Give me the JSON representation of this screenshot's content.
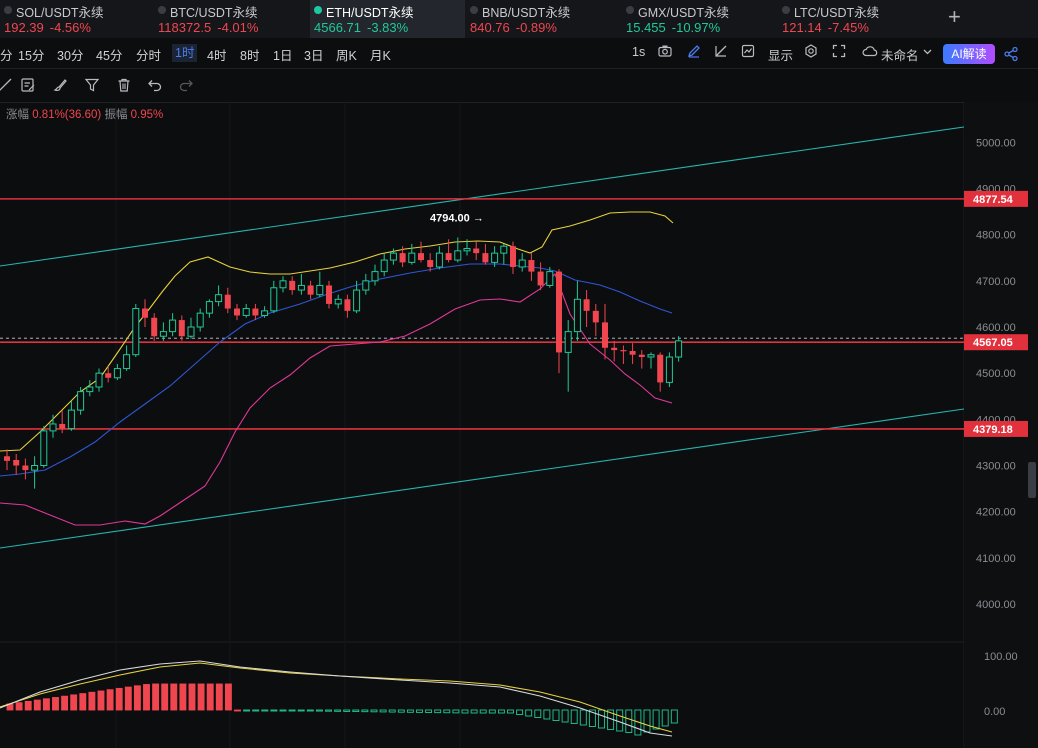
{
  "tabs": [
    {
      "symbol": "SOL/USDT永续",
      "price": "192.39",
      "change": "-4.56%",
      "dir": "down"
    },
    {
      "symbol": "BTC/USDT永续",
      "price": "118372.5",
      "change": "-4.01%",
      "dir": "down"
    },
    {
      "symbol": "ETH/USDT永续",
      "price": "4566.71",
      "change": "-3.83%",
      "dir": "up",
      "active": true
    },
    {
      "symbol": "BNB/USDT永续",
      "price": "840.76",
      "change": "-0.89%",
      "dir": "down"
    },
    {
      "symbol": "GMX/USDT永续",
      "price": "15.455",
      "change": "-10.97%",
      "dir": "up"
    },
    {
      "symbol": "LTC/USDT永续",
      "price": "121.14",
      "change": "-7.45%",
      "dir": "down"
    }
  ],
  "add_tab": "+",
  "timeframes": [
    "分",
    "15分",
    "30分",
    "45分",
    "分时",
    "1时",
    "4时",
    "8时",
    "1日",
    "3日",
    "周K",
    "月K"
  ],
  "active_timeframe": "1时",
  "toolbar_right": {
    "interval": "1s",
    "display": "显示",
    "unnamed": "未命名",
    "ai": "AI解读"
  },
  "info": {
    "range_label": "涨幅",
    "range_value": "0.81%(36.60)",
    "amp_label": "振幅",
    "amp_value": "0.95%"
  },
  "price_axis": [
    "5000.00",
    "4900.00",
    "4800.00",
    "4700.00",
    "4600.00",
    "4500.00",
    "4400.00",
    "4300.00",
    "4200.00",
    "4100.00",
    "4000.00"
  ],
  "indicator_axis": [
    "100.00",
    "0.00"
  ],
  "price_tags": [
    {
      "value": 4877.54,
      "label": "4877.54",
      "color": "#e0313c"
    },
    {
      "value": 4567.05,
      "label": "4567.05",
      "color": "#e0313c"
    },
    {
      "value": 4379.18,
      "label": "4379.18",
      "color": "#e0313c"
    }
  ],
  "high_marker": {
    "value": 4794.0,
    "label": "4794.00 →"
  },
  "colors": {
    "up": "#20c997",
    "down": "#f0464f",
    "hline": "#e0313c",
    "channel": "#26b5b0",
    "bb_upper": "#e8d23c",
    "ma": "#2f56d6",
    "bb_lower": "#e0389a"
  },
  "chart_data": {
    "type": "candlestick",
    "ylim": [
      3990,
      5030
    ],
    "candles": [
      [
        4320,
        4310,
        4335,
        4290
      ],
      [
        4312,
        4300,
        4325,
        4280
      ],
      [
        4300,
        4290,
        4315,
        4270
      ],
      [
        4290,
        4300,
        4320,
        4250
      ],
      [
        4300,
        4375,
        4385,
        4295
      ],
      [
        4375,
        4390,
        4410,
        4360
      ],
      [
        4390,
        4380,
        4420,
        4370
      ],
      [
        4380,
        4420,
        4440,
        4375
      ],
      [
        4420,
        4460,
        4470,
        4410
      ],
      [
        4460,
        4470,
        4485,
        4450
      ],
      [
        4470,
        4500,
        4510,
        4460
      ],
      [
        4500,
        4490,
        4515,
        4480
      ],
      [
        4490,
        4510,
        4520,
        4485
      ],
      [
        4510,
        4540,
        4560,
        4505
      ],
      [
        4540,
        4640,
        4650,
        4535
      ],
      [
        4640,
        4620,
        4660,
        4600
      ],
      [
        4620,
        4580,
        4630,
        4570
      ],
      [
        4580,
        4590,
        4610,
        4570
      ],
      [
        4590,
        4615,
        4630,
        4580
      ],
      [
        4615,
        4580,
        4625,
        4570
      ],
      [
        4580,
        4600,
        4620,
        4575
      ],
      [
        4600,
        4630,
        4640,
        4590
      ],
      [
        4630,
        4655,
        4660,
        4620
      ],
      [
        4655,
        4670,
        4690,
        4645
      ],
      [
        4670,
        4640,
        4685,
        4630
      ],
      [
        4640,
        4625,
        4650,
        4615
      ],
      [
        4625,
        4640,
        4650,
        4620
      ],
      [
        4640,
        4625,
        4650,
        4615
      ],
      [
        4625,
        4635,
        4645,
        4620
      ],
      [
        4635,
        4685,
        4700,
        4630
      ],
      [
        4685,
        4700,
        4710,
        4675
      ],
      [
        4700,
        4680,
        4710,
        4670
      ],
      [
        4680,
        4690,
        4715,
        4670
      ],
      [
        4690,
        4670,
        4700,
        4660
      ],
      [
        4670,
        4690,
        4720,
        4665
      ],
      [
        4690,
        4650,
        4700,
        4640
      ],
      [
        4650,
        4660,
        4670,
        4640
      ],
      [
        4660,
        4635,
        4670,
        4620
      ],
      [
        4635,
        4680,
        4700,
        4630
      ],
      [
        4680,
        4700,
        4715,
        4670
      ],
      [
        4700,
        4720,
        4735,
        4690
      ],
      [
        4720,
        4745,
        4760,
        4710
      ],
      [
        4745,
        4760,
        4770,
        4735
      ],
      [
        4760,
        4740,
        4775,
        4730
      ],
      [
        4740,
        4760,
        4780,
        4735
      ],
      [
        4760,
        4745,
        4785,
        4740
      ],
      [
        4745,
        4730,
        4760,
        4720
      ],
      [
        4730,
        4760,
        4775,
        4725
      ],
      [
        4760,
        4745,
        4790,
        4740
      ],
      [
        4745,
        4765,
        4794,
        4740
      ],
      [
        4765,
        4770,
        4790,
        4755
      ],
      [
        4770,
        4760,
        4785,
        4745
      ],
      [
        4760,
        4740,
        4780,
        4735
      ],
      [
        4740,
        4760,
        4775,
        4730
      ],
      [
        4760,
        4775,
        4780,
        4735
      ],
      [
        4775,
        4730,
        4785,
        4715
      ],
      [
        4730,
        4745,
        4760,
        4720
      ],
      [
        4745,
        4720,
        4760,
        4700
      ],
      [
        4720,
        4690,
        4740,
        4680
      ],
      [
        4690,
        4720,
        4730,
        4685
      ],
      [
        4720,
        4545,
        4725,
        4500
      ],
      [
        4545,
        4590,
        4615,
        4460
      ],
      [
        4590,
        4660,
        4700,
        4570
      ],
      [
        4660,
        4635,
        4680,
        4600
      ],
      [
        4635,
        4610,
        4650,
        4580
      ],
      [
        4610,
        4555,
        4650,
        4530
      ],
      [
        4555,
        4550,
        4570,
        4525
      ],
      [
        4550,
        4548,
        4560,
        4520
      ],
      [
        4548,
        4540,
        4565,
        4520
      ],
      [
        4540,
        4535,
        4550,
        4510
      ],
      [
        4535,
        4540,
        4545,
        4510
      ],
      [
        4540,
        4480,
        4545,
        4460
      ],
      [
        4480,
        4535,
        4545,
        4470
      ],
      [
        4535,
        4570,
        4580,
        4525
      ]
    ]
  }
}
